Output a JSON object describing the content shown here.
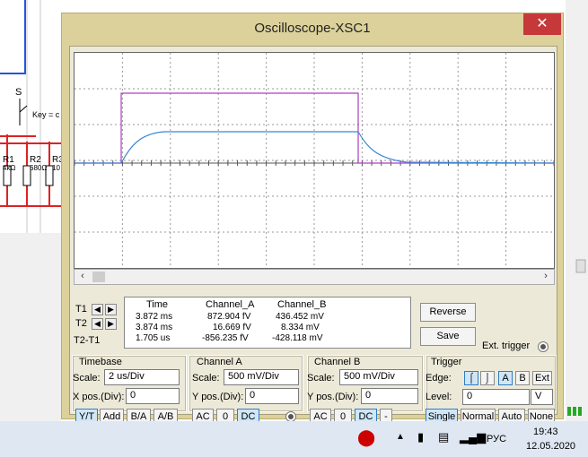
{
  "window": {
    "title": "Oscilloscope-XSC1",
    "close": "✕"
  },
  "circuit": {
    "switch": "S",
    "key": "Key = c",
    "r1_name": "R1",
    "r1_val": "4kΩ",
    "r2_name": "R2",
    "r2_val": "680Ω",
    "r3_name": "R3",
    "r3_val": "10"
  },
  "cursors": {
    "t1": "T1",
    "t2": "T2",
    "t2t1": "T2-T1"
  },
  "measure": {
    "headers": [
      "Time",
      "Channel_A",
      "Channel_B"
    ],
    "rows": [
      [
        "3.872 ms",
        "872.904 fV",
        "436.452 mV"
      ],
      [
        "3.874 ms",
        "16.669 fV",
        "8.334 mV"
      ],
      [
        "1.705 us",
        "-856.235 fV",
        "-428.118 mV"
      ]
    ]
  },
  "buttons": {
    "reverse": "Reverse",
    "save": "Save",
    "ext_trigger": "Ext. trigger"
  },
  "timebase": {
    "title": "Timebase",
    "scale_label": "Scale:",
    "scale": "2 us/Div",
    "xpos_label": "X pos.(Div):",
    "xpos": "0",
    "modes": [
      "Y/T",
      "Add",
      "B/A",
      "A/B"
    ]
  },
  "channel_a": {
    "title": "Channel A",
    "scale_label": "Scale:",
    "scale": "500 mV/Div",
    "ypos_label": "Y pos.(Div):",
    "ypos": "0",
    "coupling": [
      "AC",
      "0",
      "DC"
    ]
  },
  "channel_b": {
    "title": "Channel B",
    "scale_label": "Scale:",
    "scale": "500 mV/Div",
    "ypos_label": "Y pos.(Div):",
    "ypos": "0",
    "coupling": [
      "AC",
      "0",
      "DC",
      "-"
    ]
  },
  "trigger": {
    "title": "Trigger",
    "edge_label": "Edge:",
    "edges": [
      "A",
      "B",
      "Ext"
    ],
    "level_label": "Level:",
    "level": "0",
    "level_unit": "V",
    "modes": [
      "Single",
      "Normal",
      "Auto",
      "None"
    ]
  },
  "taskbar": {
    "lang": "РУС",
    "time": "19:43",
    "date": "12.05.2020"
  },
  "colors": {
    "channel_a": "#b23cc4",
    "channel_b": "#3b87d6",
    "window": "#dcd19a"
  }
}
